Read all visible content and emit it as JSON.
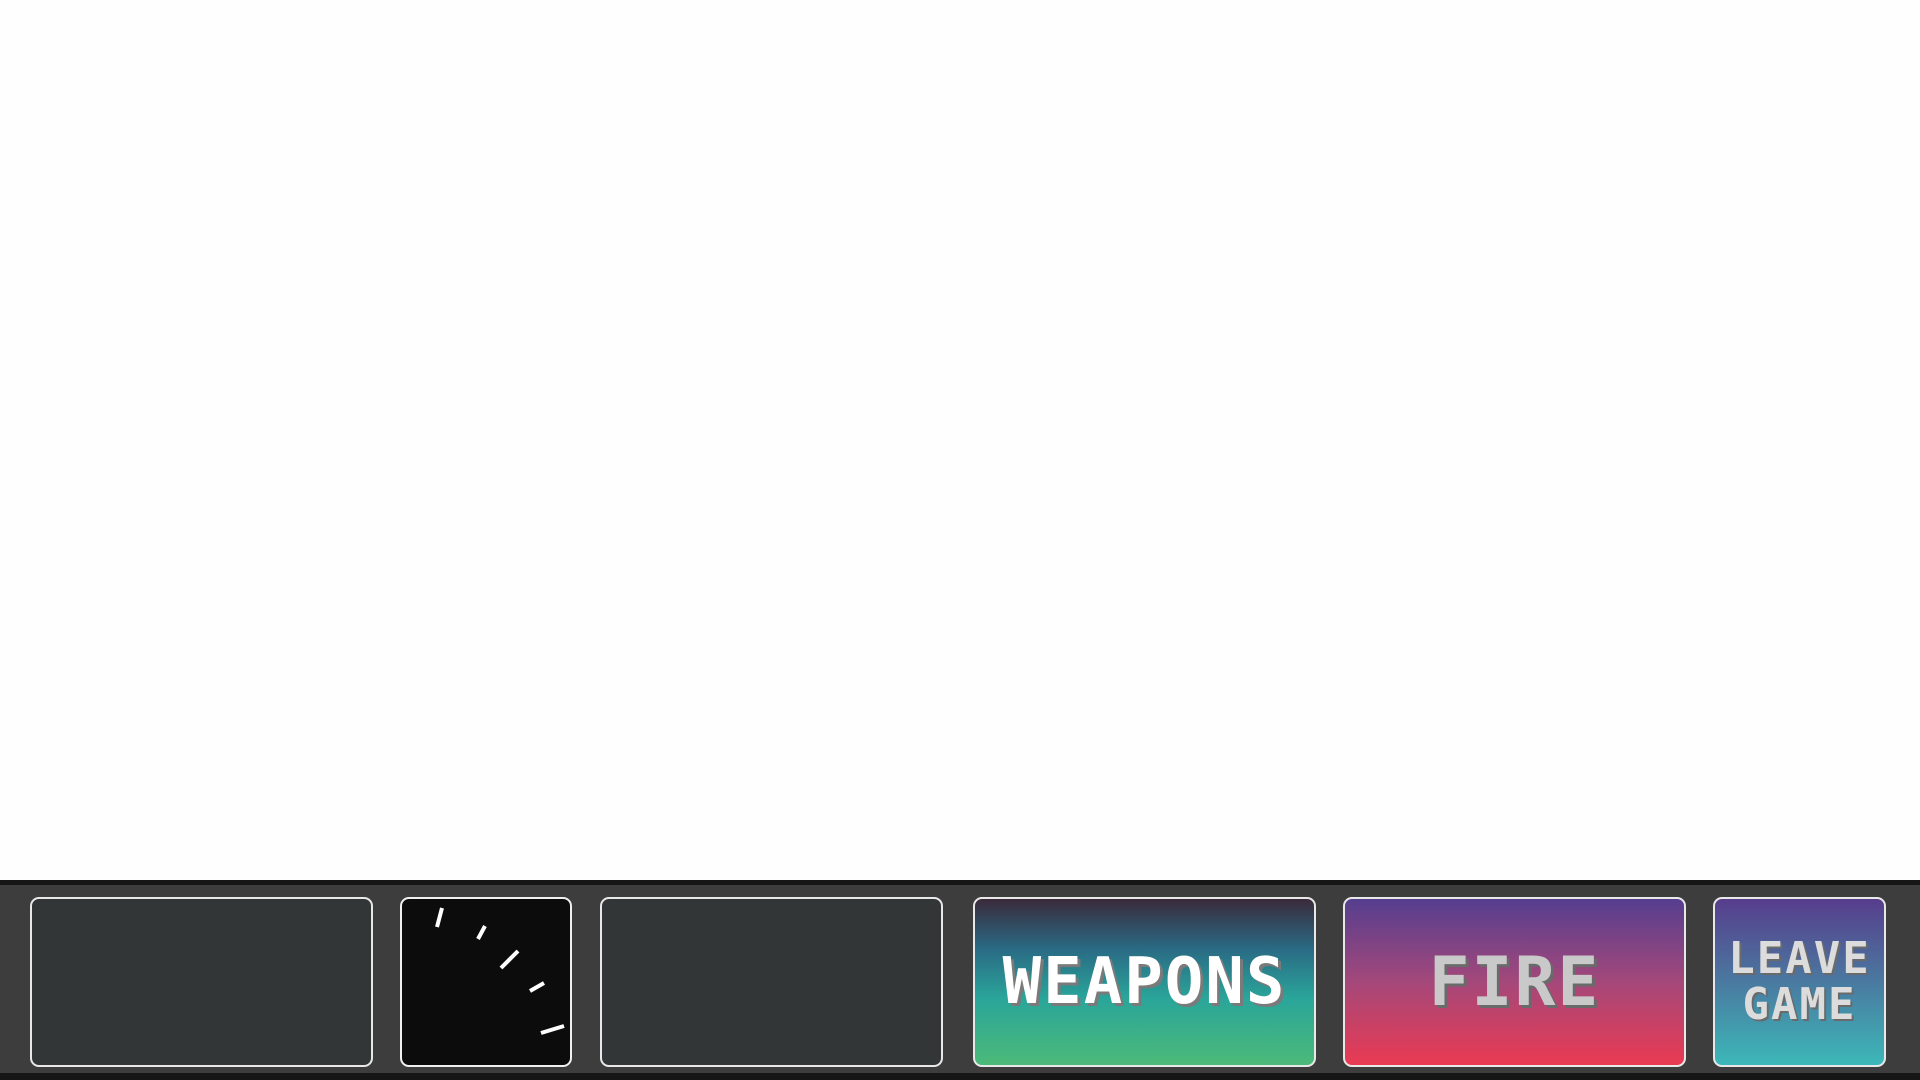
{
  "hud": {
    "weapons_label": "WEAPONS",
    "fire_label": "FIRE",
    "leave_label_line1": "LEAVE",
    "leave_label_line2": "GAME"
  },
  "colors": {
    "hud_background": "#3d3d3d",
    "panel_empty": "#323637",
    "panel_border": "#e8e8e8",
    "gauge_background": "#0c0c0c",
    "tick_color": "#ffffff"
  },
  "icons": {
    "gauge": "gauge-ticks-icon"
  }
}
